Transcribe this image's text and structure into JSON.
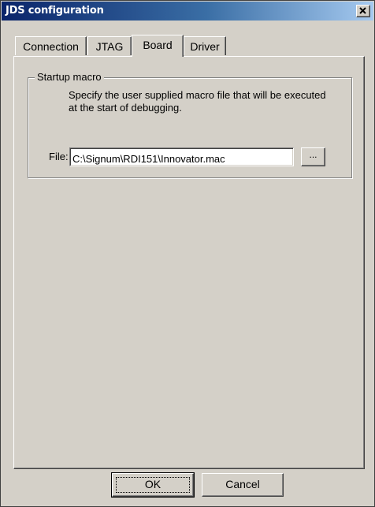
{
  "window": {
    "title": "JDS configuration"
  },
  "tabs": [
    {
      "label": "Connection",
      "active": false
    },
    {
      "label": "JTAG",
      "active": false
    },
    {
      "label": "Board",
      "active": true
    },
    {
      "label": "Driver",
      "active": false
    }
  ],
  "startup_macro": {
    "group_title": "Startup macro",
    "description": "Specify the user supplied macro file that will be executed at the start of debugging.",
    "file_label": "File:",
    "file_value": "C:\\Signum\\RDI151\\Innovator.mac",
    "browse_label": "..."
  },
  "buttons": {
    "ok": "OK",
    "cancel": "Cancel"
  },
  "colors": {
    "face": "#d4d0c8",
    "title_start": "#0a246a",
    "title_end": "#a6caf0"
  }
}
